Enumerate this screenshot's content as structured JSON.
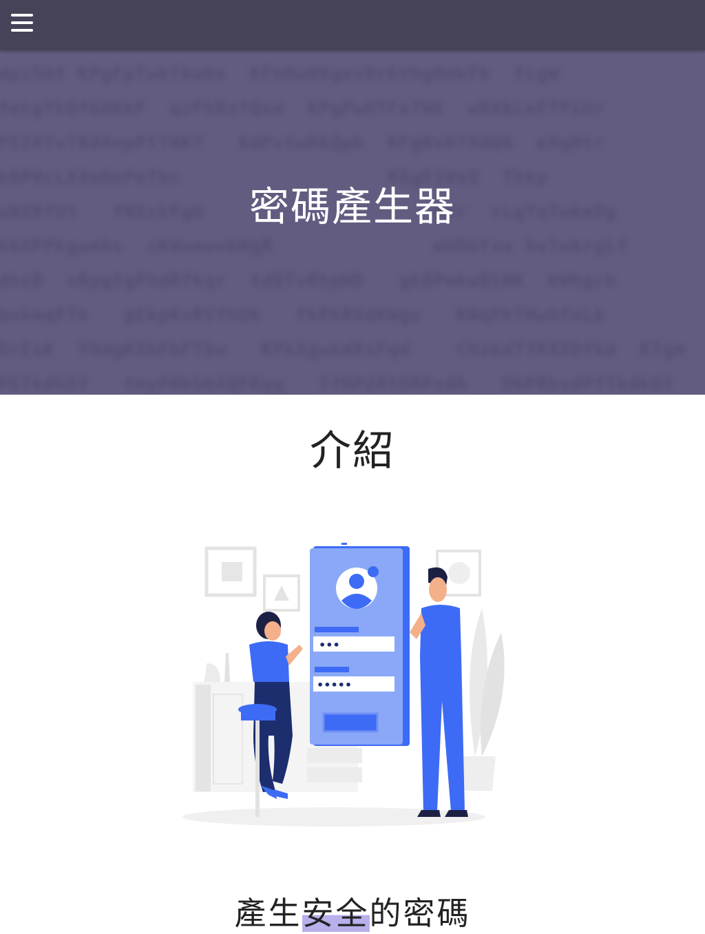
{
  "header": {
    "menu_icon": "hamburger-menu-icon",
    "bar_color": "#464258"
  },
  "hero": {
    "title": "密碼產生器",
    "background_color": "#615c80"
  },
  "intro": {
    "title": "介紹",
    "illustration_icon": "login-illustration",
    "masked_password_1": "•••",
    "masked_password_2": "•••••"
  },
  "feature": {
    "title_part1": "產生",
    "title_highlight": "安全",
    "title_part2": "的密碼",
    "highlight_color": "#b7b0ea"
  },
  "colors": {
    "accent_blue": "#3d6bf5",
    "panel_blue": "#8aa8f7"
  }
}
